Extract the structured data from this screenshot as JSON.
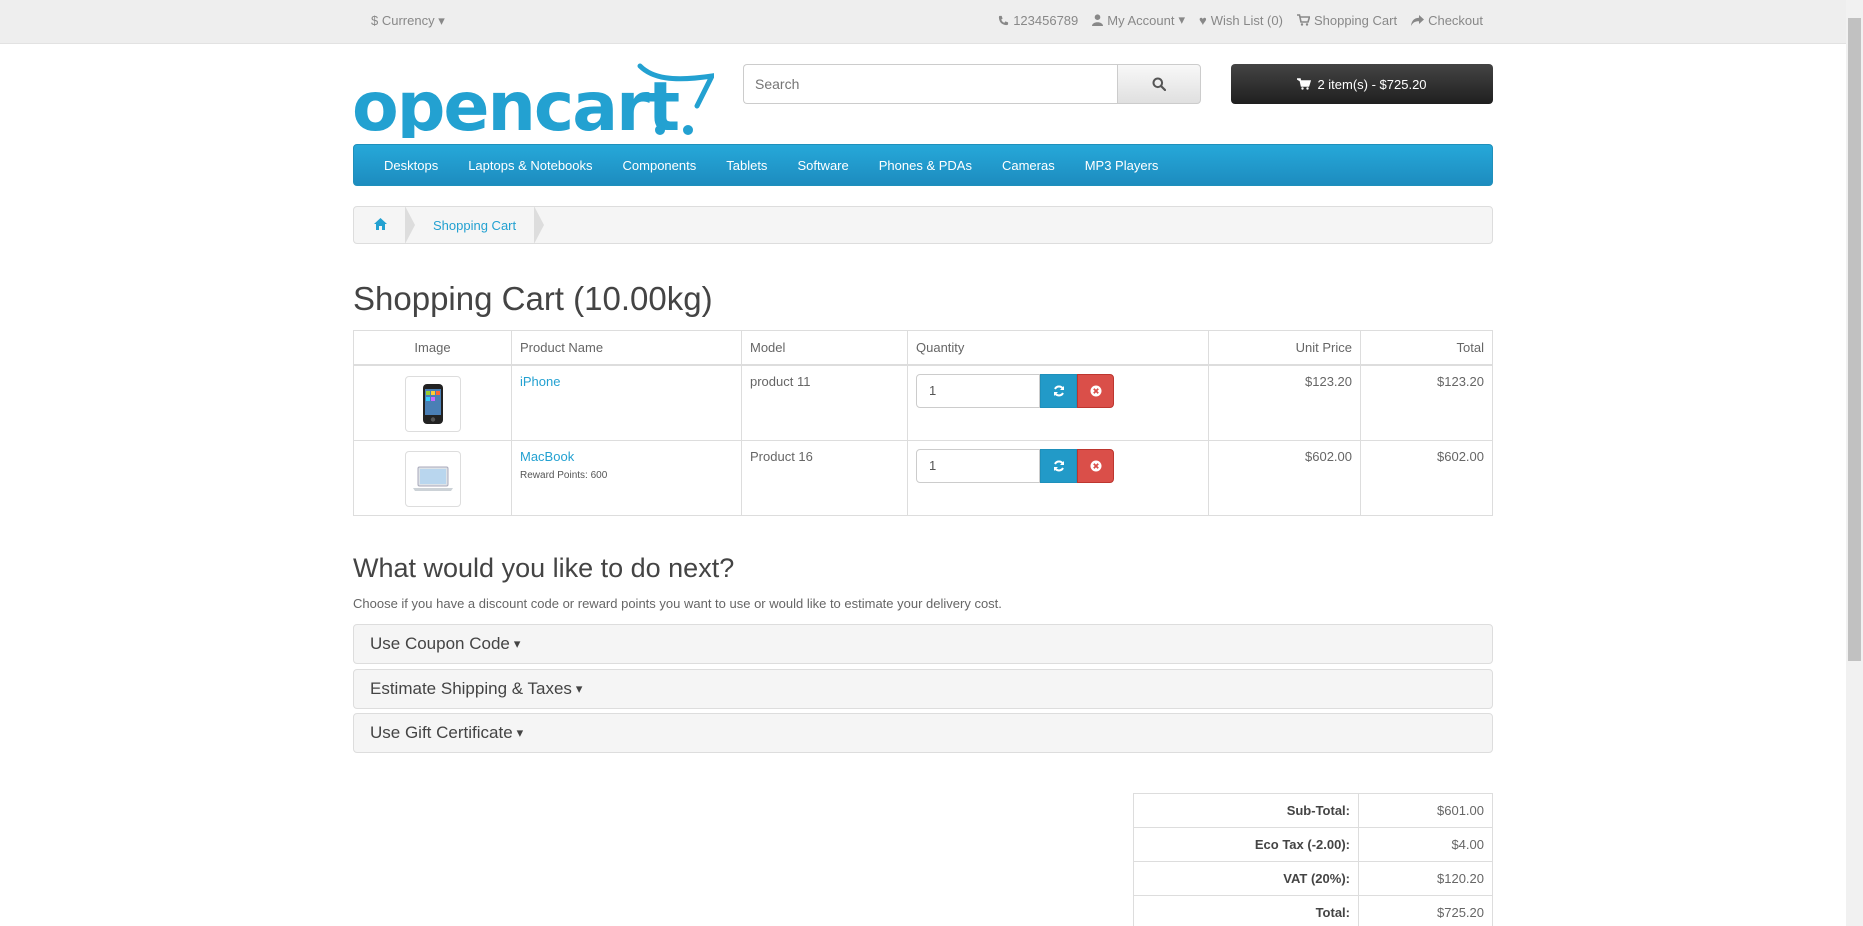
{
  "topbar": {
    "currency_label": "Currency",
    "currency_symbol": "$",
    "phone": "123456789",
    "my_account": "My Account",
    "wish_list": "Wish List (0)",
    "shopping_cart": "Shopping Cart",
    "checkout": "Checkout"
  },
  "header": {
    "logo_text": "opencart",
    "search_placeholder": "Search",
    "cart_button": "2 item(s) - $725.20"
  },
  "nav": {
    "items": [
      "Desktops",
      "Laptops & Notebooks",
      "Components",
      "Tablets",
      "Software",
      "Phones & PDAs",
      "Cameras",
      "MP3 Players"
    ]
  },
  "breadcrumb": {
    "current": "Shopping Cart"
  },
  "page": {
    "title": "Shopping Cart  (10.00kg)"
  },
  "cart": {
    "headers": {
      "image": "Image",
      "name": "Product Name",
      "model": "Model",
      "quantity": "Quantity",
      "unit_price": "Unit Price",
      "total": "Total"
    },
    "rows": [
      {
        "name": "iPhone",
        "note": "",
        "model": "product 11",
        "qty": "1",
        "unit_price": "$123.20",
        "total": "$123.20"
      },
      {
        "name": "MacBook",
        "note": "Reward Points: 600",
        "model": "Product 16",
        "qty": "1",
        "unit_price": "$602.00",
        "total": "$602.00"
      }
    ]
  },
  "next": {
    "heading": "What would you like to do next?",
    "intro": "Choose if you have a discount code or reward points you want to use or would like to estimate your delivery cost.",
    "panels": [
      "Use Coupon Code",
      "Estimate Shipping & Taxes",
      "Use Gift Certificate"
    ]
  },
  "totals": [
    {
      "label": "Sub-Total:",
      "value": "$601.00"
    },
    {
      "label": "Eco Tax (-2.00):",
      "value": "$4.00"
    },
    {
      "label": "VAT (20%):",
      "value": "$120.20"
    },
    {
      "label": "Total:",
      "value": "$725.20"
    }
  ],
  "colors": {
    "accent": "#229ac8",
    "danger": "#da4f49",
    "cart_button": "#303030",
    "link": "#23a1d1"
  }
}
